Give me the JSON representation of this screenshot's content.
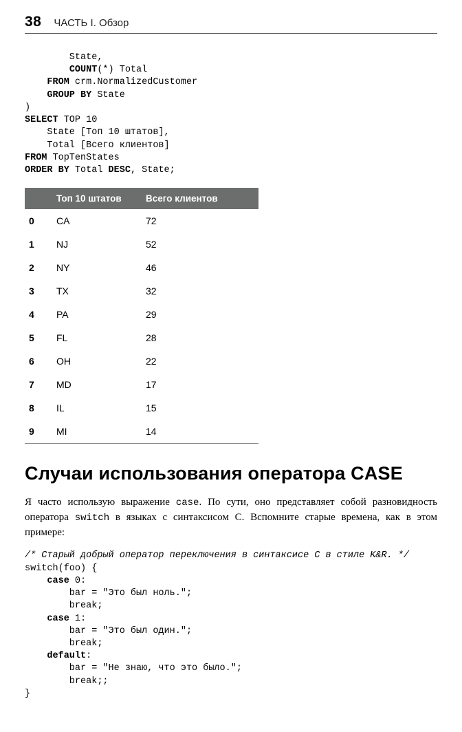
{
  "header": {
    "page_number": "38",
    "section": "ЧАСТЬ I. Обзор"
  },
  "sql_code": {
    "l1": "        State,",
    "l2a": "        ",
    "l2b": "COUNT",
    "l2c": "(*) Total",
    "l3a": "    ",
    "l3b": "FROM",
    "l3c": " crm.NormalizedCustomer",
    "l4a": "    ",
    "l4b": "GROUP BY",
    "l4c": " State",
    "l5": ")",
    "l6a": "SELECT",
    "l6b": " TOP 10",
    "l7": "    State [Топ 10 штатов],",
    "l8": "    Total [Всего клиентов]",
    "l9a": "FROM",
    "l9b": " TopTenStates",
    "l10a": "ORDER BY",
    "l10b": " Total ",
    "l10c": "DESC",
    "l10d": ", State;"
  },
  "chart_data": {
    "type": "table",
    "title": "",
    "columns": [
      "",
      "Топ 10 штатов",
      "Всего клиентов"
    ],
    "rows": [
      {
        "idx": "0",
        "state": "CA",
        "total": "72"
      },
      {
        "idx": "1",
        "state": "NJ",
        "total": "52"
      },
      {
        "idx": "2",
        "state": "NY",
        "total": "46"
      },
      {
        "idx": "3",
        "state": "TX",
        "total": "32"
      },
      {
        "idx": "4",
        "state": "PA",
        "total": "29"
      },
      {
        "idx": "5",
        "state": "FL",
        "total": "28"
      },
      {
        "idx": "6",
        "state": "OH",
        "total": "22"
      },
      {
        "idx": "7",
        "state": "MD",
        "total": "17"
      },
      {
        "idx": "8",
        "state": "IL",
        "total": "15"
      },
      {
        "idx": "9",
        "state": "MI",
        "total": "14"
      }
    ]
  },
  "section_heading": "Случаи использования оператора CASE",
  "paragraph": {
    "p1a": "Я часто использую выражение ",
    "p1b": "case",
    "p1c": ". По сути, оно представляет собой разновидность оператора ",
    "p1d": "switch",
    "p1e": " в языках с синтаксисом C. Вспомните старые времена, как в этом примере:"
  },
  "c_code": {
    "l1": "/* Старый добрый оператор переключения в синтаксисе C в стиле K&R. */",
    "l2": "switch(foo) {",
    "l3a": "    ",
    "l3b": "case",
    "l3c": " 0:",
    "l4": "        bar = \"Это был ноль.\";",
    "l5": "        break;",
    "l6a": "    ",
    "l6b": "case",
    "l6c": " 1:",
    "l7": "        bar = \"Это был один.\";",
    "l8": "        break;",
    "l9a": "    ",
    "l9b": "default",
    "l9c": ":",
    "l10": "        bar = \"Не знаю, что это было.\";",
    "l11": "        break;;",
    "l12": "}"
  }
}
